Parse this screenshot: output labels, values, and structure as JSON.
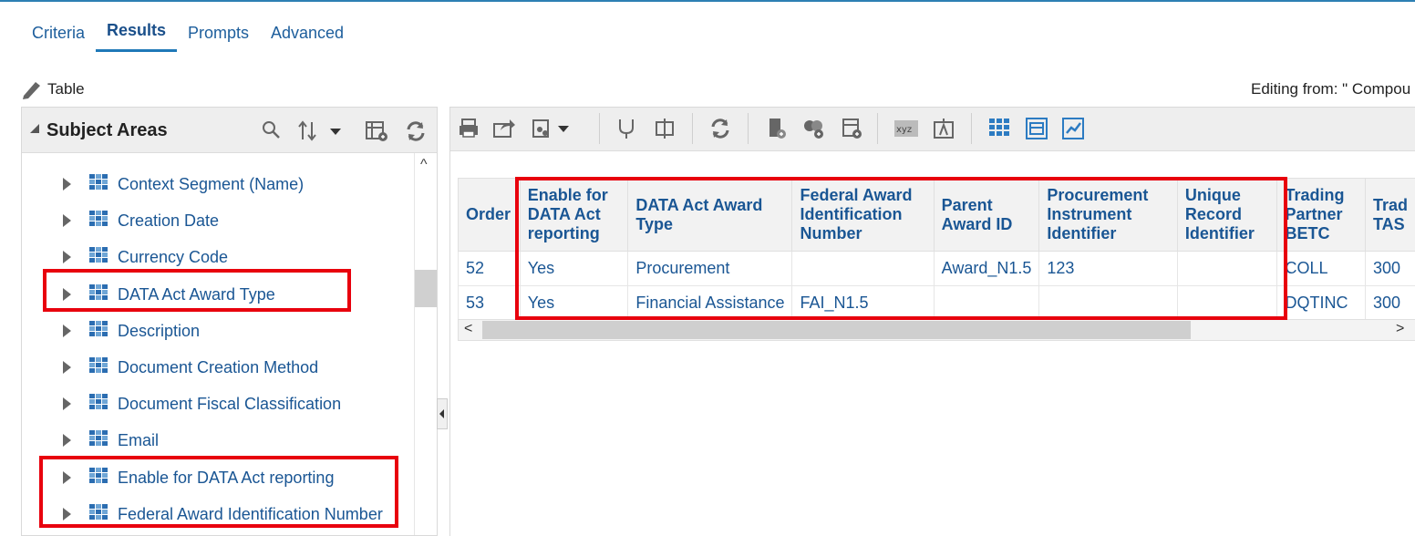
{
  "tabs": [
    {
      "label": "Criteria"
    },
    {
      "label": "Results"
    },
    {
      "label": "Prompts"
    },
    {
      "label": "Advanced"
    }
  ],
  "view_label": "Table",
  "editing_from": "Editing from: \" Compou",
  "subject_areas": {
    "title": "Subject Areas",
    "items": [
      {
        "label": "Context Segment (Name)"
      },
      {
        "label": "Creation Date"
      },
      {
        "label": "Currency Code"
      },
      {
        "label": "DATA Act Award Type"
      },
      {
        "label": "Description"
      },
      {
        "label": "Document Creation Method"
      },
      {
        "label": "Document Fiscal Classification"
      },
      {
        "label": "Email"
      },
      {
        "label": "Enable for DATA Act reporting"
      },
      {
        "label": "Federal Award Identification Number"
      }
    ]
  },
  "table": {
    "headers": [
      "Order",
      "Enable for DATA Act reporting",
      "DATA Act Award Type",
      "Federal Award Identification Number",
      "Parent Award ID",
      "Procurement Instrument Identifier",
      "Unique Record Identifier",
      "Trading Partner BETC",
      "Trad TAS"
    ],
    "rows": [
      [
        "52",
        "Yes",
        "Procurement",
        "",
        "Award_N1.5",
        "123",
        "",
        "COLL",
        "300"
      ],
      [
        "53",
        "Yes",
        "Financial Assistance",
        "FAI_N1.5",
        "",
        "",
        "",
        "DQTINC",
        "300"
      ]
    ]
  },
  "highlight_color": "#e8000d"
}
